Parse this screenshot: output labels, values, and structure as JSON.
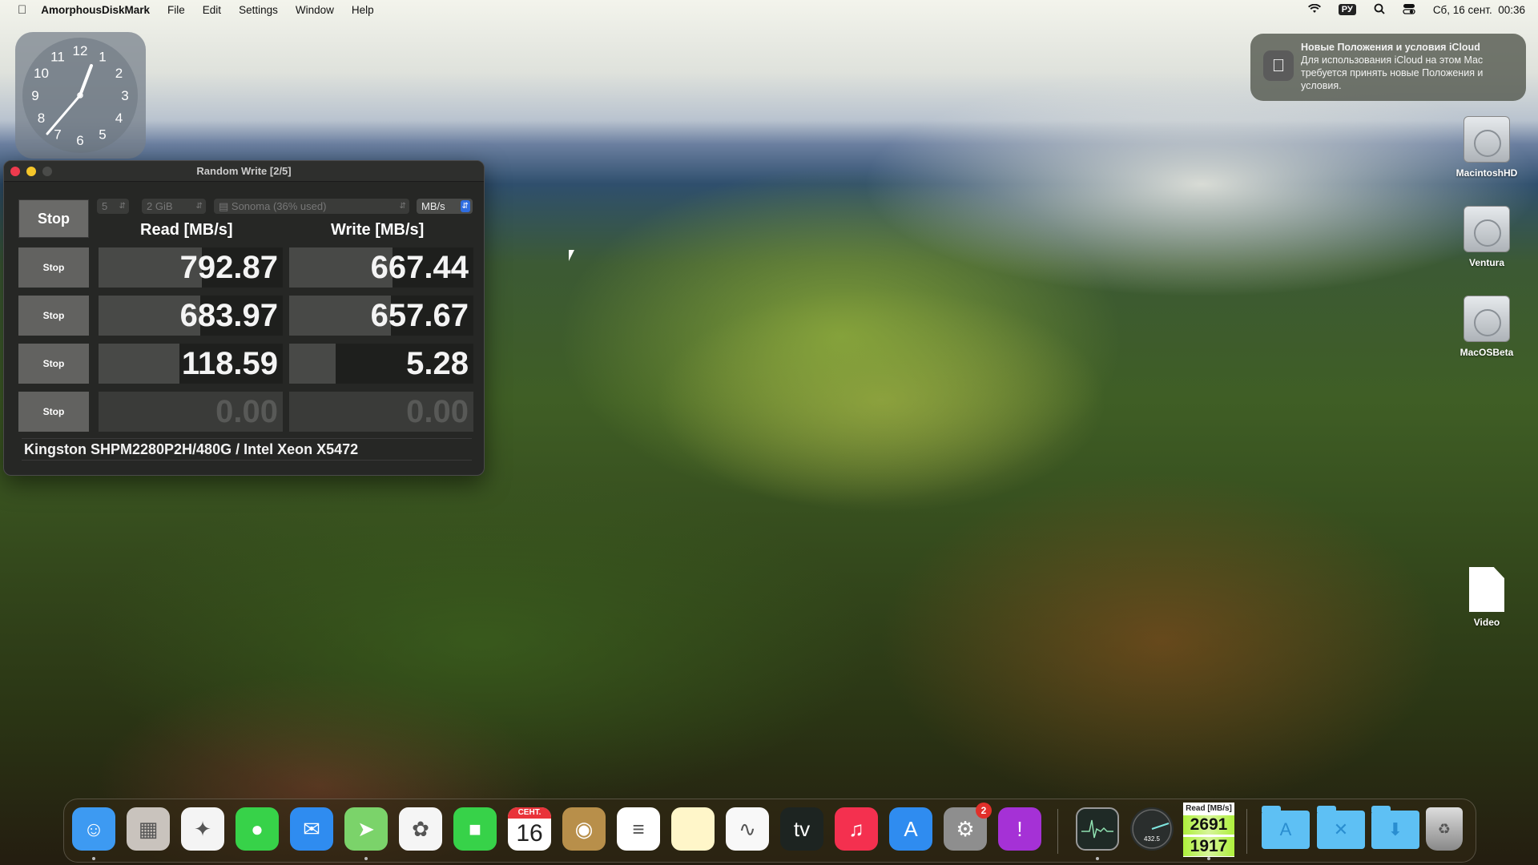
{
  "menubar": {
    "apple_icon": "apple-logo",
    "app_name": "AmorphousDiskMark",
    "menus": [
      "File",
      "Edit",
      "Settings",
      "Window",
      "Help"
    ],
    "status": {
      "wifi_icon": "wifi",
      "input_source": "РУ",
      "search_icon": "magnifier",
      "control_center_icon": "toggles",
      "datetime": "Сб, 16 сент.  00:36"
    }
  },
  "clock_widget": {
    "numbers": [
      "12",
      "1",
      "2",
      "3",
      "4",
      "5",
      "6",
      "7",
      "8",
      "9",
      "10",
      "11"
    ],
    "time": "00:36"
  },
  "notification": {
    "icon": "apple-logo",
    "title": "Новые Положения и условия iCloud",
    "body": "Для использования iCloud на этом Mac требуется принять новые Положения и условия."
  },
  "window": {
    "title": "Random Write [2/5]",
    "main_button": "Stop",
    "count_select": "5",
    "size_select": "2 GiB",
    "drive_select": "Sonoma (36% used)",
    "unit_select": "MB/s",
    "read_header": "Read [MB/s]",
    "write_header": "Write [MB/s]",
    "rows": [
      {
        "button": "Stop",
        "read": "792.87",
        "write": "667.44",
        "read_fill": 0.56,
        "write_fill": 0.56
      },
      {
        "button": "Stop",
        "read": "683.97",
        "write": "657.67",
        "read_fill": 0.55,
        "write_fill": 0.55
      },
      {
        "button": "Stop",
        "read": "118.59",
        "write": "5.28",
        "read_fill": 0.44,
        "write_fill": 0.25
      },
      {
        "button": "Stop",
        "read": "0.00",
        "write": "0.00",
        "read_fill": 0,
        "write_fill": 0
      }
    ],
    "info": "Kingston SHPM2280P2H/480G / Intel Xeon X5472"
  },
  "desktop_icons": [
    {
      "label": "MacintoshHD",
      "icon": "hard-drive"
    },
    {
      "label": "Ventura",
      "icon": "hard-drive"
    },
    {
      "label": "MacOSBeta",
      "icon": "hard-drive"
    },
    {
      "label": "Video",
      "icon": "document-alias"
    }
  ],
  "dock": {
    "apps": [
      {
        "name": "Finder",
        "glyph": "☺",
        "color": "#3d9af2",
        "running": true
      },
      {
        "name": "Launchpad",
        "glyph": "▦",
        "color": "#c9c3bd",
        "running": false
      },
      {
        "name": "Safari",
        "glyph": "✦",
        "color": "#f4f4f4",
        "running": false
      },
      {
        "name": "Messages",
        "glyph": "●",
        "color": "#37d249",
        "running": false
      },
      {
        "name": "Mail",
        "glyph": "✉",
        "color": "#2f8cf0",
        "running": false
      },
      {
        "name": "Maps",
        "glyph": "➤",
        "color": "#7bd36a",
        "running": true
      },
      {
        "name": "Photos",
        "glyph": "✿",
        "color": "#f5f5f5",
        "running": false
      },
      {
        "name": "FaceTime",
        "glyph": "■",
        "color": "#37d249",
        "running": false
      },
      {
        "name": "Calendar",
        "glyph": "16",
        "month": "СЕНТ.",
        "color": "#ffffff",
        "running": false
      },
      {
        "name": "Contacts",
        "glyph": "◉",
        "color": "#b88f4a",
        "running": false
      },
      {
        "name": "Reminders",
        "glyph": "≡",
        "color": "#ffffff",
        "running": false
      },
      {
        "name": "Notes",
        "glyph": "",
        "color": "#fff6c9",
        "running": false
      },
      {
        "name": "Freeform",
        "glyph": "∿",
        "color": "#f8f8f8",
        "running": false
      },
      {
        "name": "TV",
        "glyph": "tv",
        "color": "#1d2421",
        "running": false
      },
      {
        "name": "Music",
        "glyph": "♫",
        "color": "#f4304f",
        "running": false
      },
      {
        "name": "App Store",
        "glyph": "A",
        "color": "#2f8cf0",
        "running": false
      },
      {
        "name": "System Settings",
        "glyph": "⚙",
        "color": "#8e8e8e",
        "running": false,
        "badge": "2"
      },
      {
        "name": "Feedback Assistant",
        "glyph": "!",
        "color": "#a531d6",
        "running": false
      }
    ],
    "utilities": [
      {
        "name": "Activity Monitor",
        "glyph": "∿",
        "color": "#1f2a26",
        "running": true
      },
      {
        "name": "Disk Speed Gauge",
        "gauge_value": "432.5",
        "color": "#2a2e2d",
        "running": false
      }
    ],
    "read_widget": {
      "header": "Read [MB/s]",
      "values": [
        "2691",
        "1917"
      ],
      "running": true
    },
    "folders": [
      {
        "name": "Applications",
        "glyph": "A"
      },
      {
        "name": "Utilities",
        "glyph": "✕"
      },
      {
        "name": "Downloads",
        "glyph": "⬇"
      }
    ],
    "trash": {
      "name": "Trash"
    }
  }
}
